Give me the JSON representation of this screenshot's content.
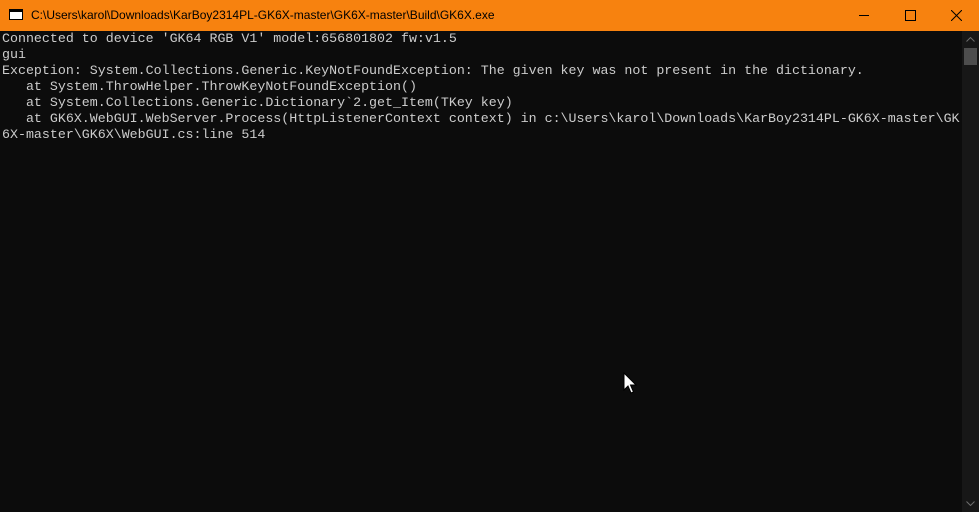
{
  "window": {
    "title": "C:\\Users\\karol\\Downloads\\KarBoy2314PL-GK6X-master\\GK6X-master\\Build\\GK6X.exe",
    "accent_color": "#f7820f",
    "controls": {
      "minimize_icon": "minimize-icon",
      "maximize_icon": "maximize-icon",
      "close_icon": "close-icon"
    }
  },
  "console": {
    "background_color": "#0c0c0c",
    "text_color": "#cccccc",
    "lines": [
      "Connected to device 'GK64 RGB V1' model:656801802 fw:v1.5",
      "gui",
      "Exception: System.Collections.Generic.KeyNotFoundException: The given key was not present in the dictionary.",
      "   at System.ThrowHelper.ThrowKeyNotFoundException()",
      "   at System.Collections.Generic.Dictionary`2.get_Item(TKey key)",
      "   at GK6X.WebGUI.WebServer.Process(HttpListenerContext context) in c:\\Users\\karol\\Downloads\\KarBoy2314PL-GK6X-master\\GK",
      "6X-master\\GK6X\\WebGUI.cs:line 514"
    ]
  }
}
